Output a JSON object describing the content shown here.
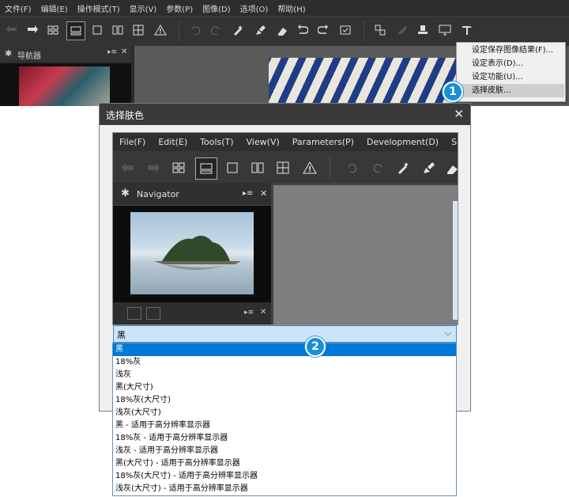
{
  "bg_menu": [
    "文件(F)",
    "编辑(E)",
    "操作模式(T)",
    "显示(V)",
    "参数(P)",
    "图像(D)",
    "选项(O)",
    "帮助(H)"
  ],
  "bg_navigator_title": "导航器",
  "context_menu": {
    "items": [
      "设定保存图像结果(F)...",
      "设定表示(D)...",
      "设定功能(U)...",
      "选择皮肤..."
    ],
    "highlighted_index": 3
  },
  "callouts": {
    "one": "1",
    "two": "2"
  },
  "dialog": {
    "title": "选择肤色",
    "close": "✕",
    "preview": {
      "menu": [
        "File(F)",
        "Edit(E)",
        "Tools(T)",
        "View(V)",
        "Parameters(P)",
        "Development(D)",
        "Setti"
      ],
      "navigator_title": "Navigator"
    },
    "select": {
      "value": "黑",
      "options": [
        "黑",
        "18%灰",
        "浅灰",
        "黑(大尺寸)",
        "18%灰(大尺寸)",
        "浅灰(大尺寸)",
        "黑 - 适用于高分辨率显示器",
        "18%灰 - 适用于高分辨率显示器",
        "浅灰 - 适用于高分辨率显示器",
        "黑(大尺寸) - 适用于高分辨率显示器",
        "18%灰(大尺寸) - 适用于高分辨率显示器",
        "浅灰(大尺寸) - 适用于高分辨率显示器"
      ],
      "selected_index": 0
    }
  },
  "colors": {
    "accent": "#0078d7",
    "callout": "#1a8fd6",
    "dark_ui": "#2b2b2b"
  }
}
